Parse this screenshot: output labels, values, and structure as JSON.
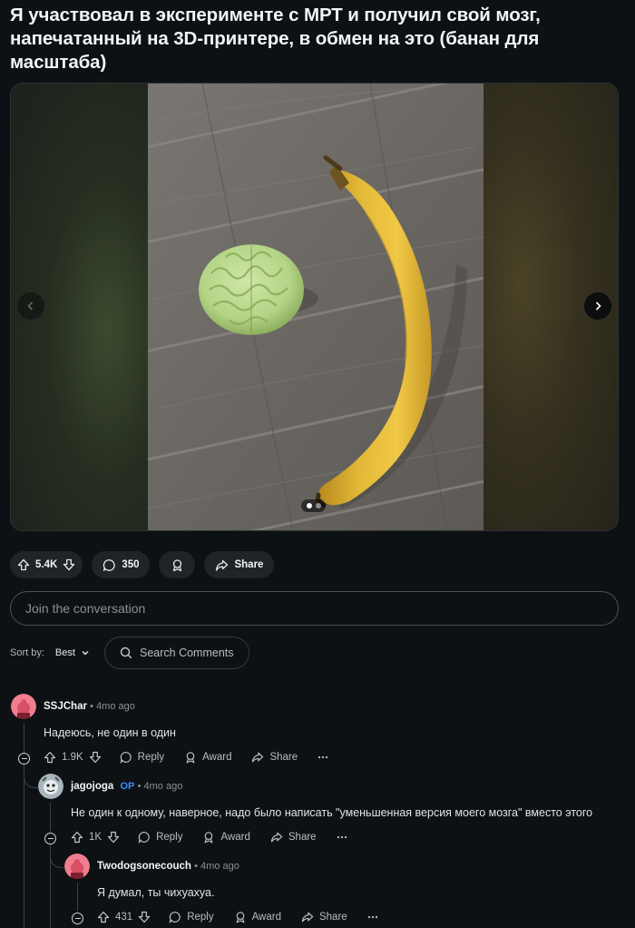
{
  "post": {
    "title": "Я участвовал в эксперименте с МРТ и получил свой мозг, напечатанный на 3D-принтере, в обмен на это (банан для масштаба)"
  },
  "gallery": {
    "current": 1,
    "total": 2
  },
  "actions": {
    "score": "5.4K",
    "comments": "350",
    "share": "Share"
  },
  "composer": {
    "placeholder": "Join the conversation"
  },
  "sort": {
    "label": "Sort by:",
    "value": "Best",
    "search_placeholder": "Search Comments"
  },
  "comments": [
    {
      "author": "SSJChar",
      "op": "",
      "time": "4mo ago",
      "text": "Надеюсь, не один в один",
      "score": "1.9K",
      "reply": "Reply",
      "award": "Award",
      "share": "Share"
    },
    {
      "author": "jagojoga",
      "op": "OP",
      "time": "4mo ago",
      "text": "Не один к одному, наверное, надо было написать \"уменьшенная версия моего мозга\" вместо этого",
      "score": "1K",
      "reply": "Reply",
      "award": "Award",
      "share": "Share"
    },
    {
      "author": "Twodogsonecouch",
      "op": "",
      "time": "4mo ago",
      "text": "Я думал, ты чихуахуа.",
      "score": "431",
      "reply": "Reply",
      "award": "Award",
      "share": "Share"
    }
  ],
  "colors": {
    "background": "#0e1113",
    "pill": "#1f2426",
    "op_badge": "#3d8bff",
    "avatar_pink": "#ef7e8f"
  }
}
